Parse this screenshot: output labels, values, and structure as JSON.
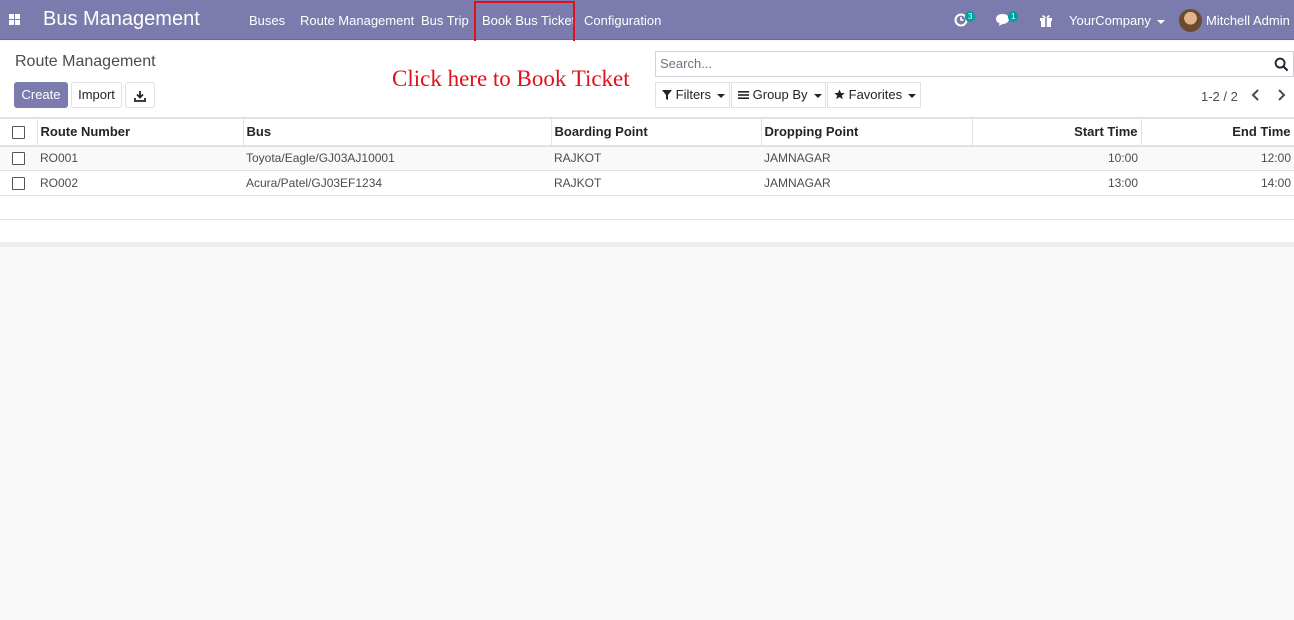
{
  "app": {
    "title": "Bus Management",
    "menu": [
      "Buses",
      "Route Management",
      "Bus Trip",
      "Book Bus Ticket",
      "Configuration"
    ],
    "activities_count": "3",
    "messages_count": "1",
    "company": "YourCompany",
    "user": "Mitchell Admin",
    "accent_color": "#7c7bad"
  },
  "control": {
    "breadcrumb": "Route Management",
    "create_label": "Create",
    "import_label": "Import",
    "annotation": "Click here to Book Ticket",
    "search_placeholder": "Search...",
    "filters_label": "Filters",
    "groupby_label": "Group By",
    "favorites_label": "Favorites",
    "pager": "1-2 / 2"
  },
  "table": {
    "headers": [
      "Route Number",
      "Bus",
      "Boarding Point",
      "Dropping Point",
      "Start Time",
      "End Time"
    ],
    "rows": [
      [
        "RO001",
        "Toyota/Eagle/GJ03AJ10001",
        "RAJKOT",
        "JAMNAGAR",
        "10:00",
        "12:00"
      ],
      [
        "RO002",
        "Acura/Patel/GJ03EF1234",
        "RAJKOT",
        "JAMNAGAR",
        "13:00",
        "14:00"
      ]
    ]
  }
}
